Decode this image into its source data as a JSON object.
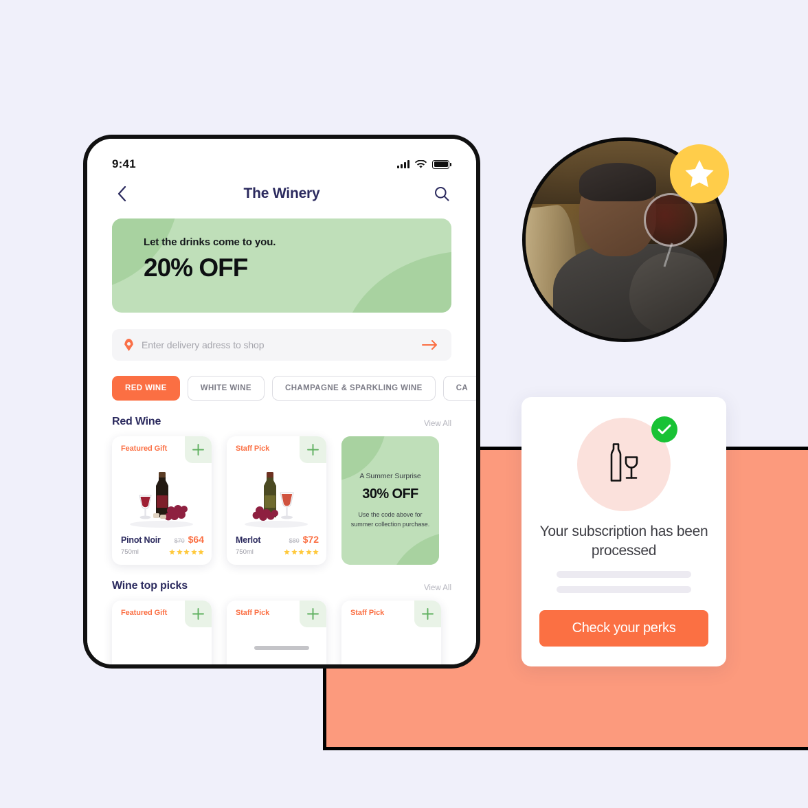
{
  "canvas": {
    "bg_color": "#f0f0fa",
    "accent_orange": "#fb6f43",
    "block_orange": "#fc9a7d",
    "green": "#bfdfb9",
    "navy": "#2b2a5e"
  },
  "phone": {
    "status_bar": {
      "time": "9:41",
      "signal_icon": "cellular-signal-icon",
      "wifi_icon": "wifi-icon",
      "battery_icon": "battery-icon"
    },
    "header": {
      "back_icon": "chevron-left-icon",
      "title": "The Winery",
      "search_icon": "search-icon"
    },
    "hero": {
      "subtitle": "Let the drinks come to you.",
      "headline": "20% OFF",
      "image": "three-wine-bottles-illustration"
    },
    "delivery": {
      "pin_icon": "location-pin-icon",
      "placeholder": "Enter delivery adress to shop",
      "value": "",
      "submit_icon": "arrow-right-icon"
    },
    "categories": [
      {
        "label": "RED WINE",
        "active": true
      },
      {
        "label": "WHITE WINE",
        "active": false
      },
      {
        "label": "CHAMPAGNE & SPARKLING WINE",
        "active": false
      },
      {
        "label": "CA",
        "active": false
      }
    ],
    "sections": [
      {
        "title": "Red Wine",
        "view_all": "View All",
        "products": [
          {
            "tag": "Featured Gift",
            "add_icon": "plus-icon",
            "name": "Pinot Noir",
            "old_price": "$70",
            "price": "$64",
            "volume": "750ml",
            "rating": 5,
            "image": "red-wine-bottle-glass-grapes"
          },
          {
            "tag": "Staff Pick",
            "add_icon": "plus-icon",
            "name": "Merlot",
            "old_price": "$80",
            "price": "$72",
            "volume": "750ml",
            "rating": 5,
            "image": "merlot-bottle-glass-grapes"
          }
        ],
        "promo": {
          "eyebrow": "A Summer Surprise",
          "headline": "30% OFF",
          "note": "Use the code above for summer collection purchase."
        }
      },
      {
        "title": "Wine top picks",
        "view_all": "View All",
        "products": [
          {
            "tag": "Featured Gift",
            "add_icon": "plus-icon"
          },
          {
            "tag": "Staff Pick",
            "add_icon": "plus-icon"
          },
          {
            "tag": "Staff Pick",
            "add_icon": "plus-icon"
          }
        ]
      }
    ],
    "home_indicator": "home-indicator"
  },
  "portrait": {
    "image": "man-tasting-red-wine-in-cellar",
    "badge_icon": "star-icon",
    "badge_color": "#ffcd4a"
  },
  "subscription": {
    "bottle_icon": "wine-bottle-and-glass-icon",
    "check_icon": "check-circle-icon",
    "check_color": "#19c235",
    "title": "Your subscription has been processed",
    "skeleton_lines": 2,
    "button_label": "Check your perks"
  }
}
